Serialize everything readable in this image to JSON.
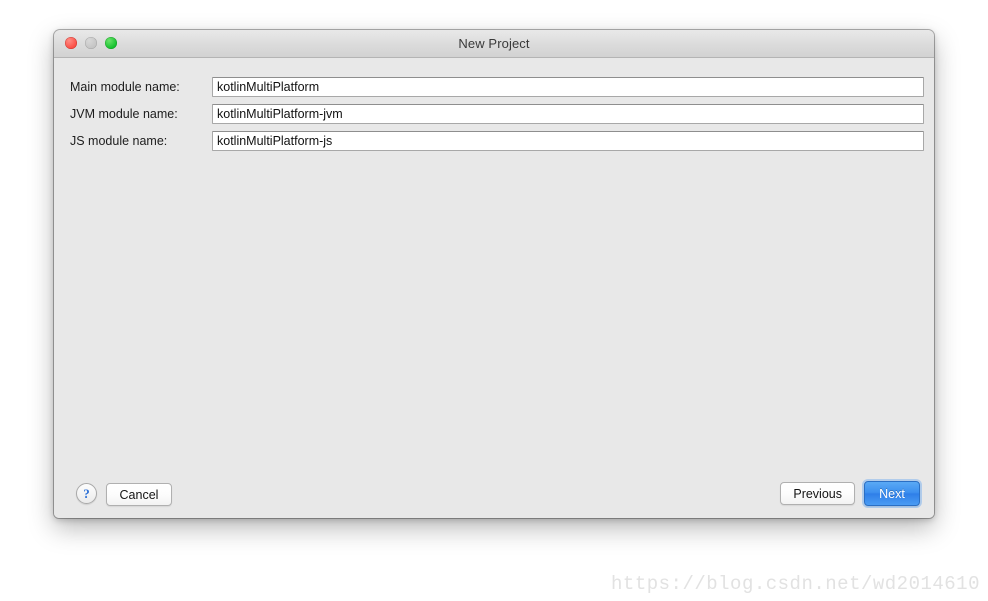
{
  "window": {
    "title": "New Project",
    "controls": {
      "close": "close-button",
      "minimize": "minimize-button",
      "maximize": "maximize-button"
    }
  },
  "form": {
    "fields": [
      {
        "label": "Main module name:",
        "value": "kotlinMultiPlatform",
        "placeholder": ""
      },
      {
        "label": "JVM module name:",
        "value": "kotlinMultiPlatform-jvm",
        "placeholder": ""
      },
      {
        "label": "JS module name:",
        "value": "kotlinMultiPlatform-js",
        "placeholder": ""
      }
    ]
  },
  "footer": {
    "help_label": "?",
    "cancel_label": "Cancel",
    "previous_label": "Previous",
    "next_label": "Next"
  },
  "watermark": {
    "text": "https://blog.csdn.net/wd2014610"
  },
  "colors": {
    "accent_blue": "#3d90ef",
    "help_blue": "#2b6fd6",
    "dialog_bg": "#e8e8e8",
    "titlebar_bg": "#dcdcdc",
    "close_red": "#fb4c42",
    "minimize_gray": "#c4c4c4",
    "maximize_green": "#12bf2c",
    "page_bg": "#ffffff"
  }
}
